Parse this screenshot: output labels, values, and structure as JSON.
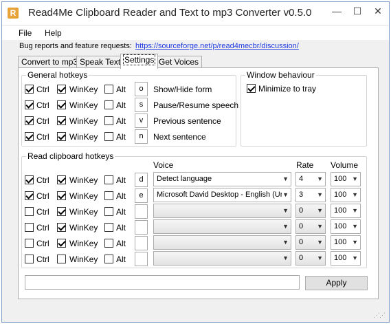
{
  "window": {
    "title": "Read4Me Clipboard Reader and Text to mp3 Converter v0.5.0",
    "icon": "R"
  },
  "menu": [
    "File",
    "Help"
  ],
  "bug": {
    "label": "Bug reports and feature requests:",
    "link": "https://sourceforge.net/p/read4mecbr/discussion/"
  },
  "tabs": [
    "Convert to mp3",
    "Speak Text",
    "Settings",
    "Get Voices"
  ],
  "active_tab": "Settings",
  "general": {
    "title": "General hotkeys",
    "rows": [
      {
        "ctrl": true,
        "win": true,
        "alt": false,
        "key": "o",
        "action": "Show/Hide form"
      },
      {
        "ctrl": true,
        "win": true,
        "alt": false,
        "key": "s",
        "action": "Pause/Resume speech"
      },
      {
        "ctrl": true,
        "win": true,
        "alt": false,
        "key": "v",
        "action": "Previous sentence"
      },
      {
        "ctrl": true,
        "win": true,
        "alt": false,
        "key": "n",
        "action": "Next sentence"
      }
    ]
  },
  "window_behaviour": {
    "title": "Window behaviour",
    "minimize_label": "Minimize to tray",
    "minimize_checked": true
  },
  "clipboard": {
    "title": "Read clipboard hotkeys",
    "headers": {
      "voice": "Voice",
      "rate": "Rate",
      "volume": "Volume"
    },
    "rows": [
      {
        "ctrl": true,
        "win": true,
        "alt": false,
        "key": "d",
        "voice": "Detect language",
        "rate": "4",
        "volume": "100",
        "active": true
      },
      {
        "ctrl": true,
        "win": true,
        "alt": false,
        "key": "e",
        "voice": "Microsoft David Desktop - English (Ur",
        "rate": "3",
        "volume": "100",
        "active": true
      },
      {
        "ctrl": false,
        "win": true,
        "alt": false,
        "key": "",
        "voice": "",
        "rate": "0",
        "volume": "100",
        "active": false
      },
      {
        "ctrl": false,
        "win": true,
        "alt": false,
        "key": "",
        "voice": "",
        "rate": "0",
        "volume": "100",
        "active": false
      },
      {
        "ctrl": false,
        "win": true,
        "alt": false,
        "key": "",
        "voice": "",
        "rate": "0",
        "volume": "100",
        "active": false
      },
      {
        "ctrl": false,
        "win": false,
        "alt": false,
        "key": "",
        "voice": "",
        "rate": "0",
        "volume": "100",
        "active": false
      }
    ]
  },
  "labels": {
    "ctrl": "Ctrl",
    "win": "WinKey",
    "alt": "Alt"
  },
  "apply_label": "Apply",
  "controls": {
    "minimize": "—",
    "maximize": "☐",
    "close": "✕"
  }
}
